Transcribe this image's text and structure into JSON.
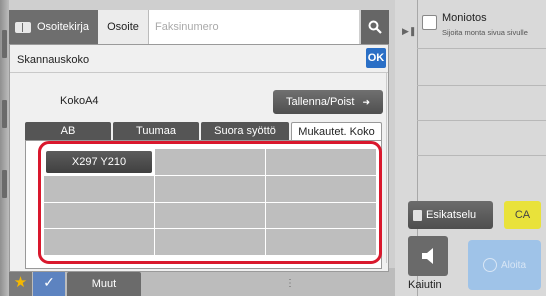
{
  "topbar": {
    "address_book_label": "Osoitekirja",
    "address_label": "Osoite",
    "fax_placeholder": "Faksinumero"
  },
  "rightpanel": {
    "monitos_title": "Moniotos",
    "monitos_sub": "Sijoita monta sivua sivulle",
    "preview_label": "Esikatselu",
    "ca_label": "CA",
    "speaker_label": "Kaiutin",
    "start_label": "Aloita"
  },
  "bottombar": {
    "more_label": "Muut"
  },
  "dialog": {
    "title": "Skannauskoko",
    "ok_label": "OK",
    "size_label": "KokoA4",
    "save_label": "Tallenna/Poist",
    "tabs": [
      {
        "label": "AB",
        "active": false
      },
      {
        "label": "Tuumaa",
        "active": false
      },
      {
        "label": "Suora syöttö",
        "active": false
      },
      {
        "label": "Mukautet. Koko",
        "active": true
      }
    ],
    "custom_sizes": [
      "X297 Y210",
      "",
      "",
      "",
      "",
      "",
      "",
      "",
      "",
      "",
      "",
      ""
    ]
  },
  "colors": {
    "accent_blue": "#2a6fc6",
    "highlight_red": "#d9182d",
    "ca_yellow": "#e9e23a",
    "start_blue": "#9fc3e8",
    "star_yellow": "#f5b800"
  }
}
